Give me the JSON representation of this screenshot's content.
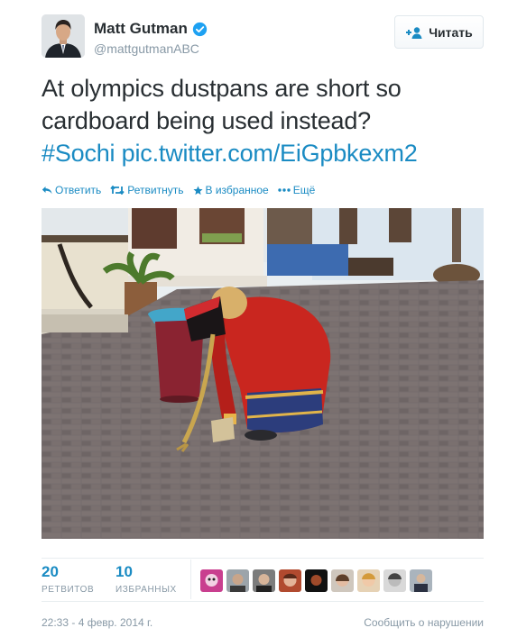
{
  "author": {
    "name": "Matt Gutman",
    "handle": "@mattgutmanABC",
    "verified": true
  },
  "follow_button": {
    "label": "Читать"
  },
  "tweet": {
    "text": "At olympics dustpans are short so cardboard being used instead?",
    "hashtag": "#Sochi",
    "link": "pic.twitter.com/EiGpbkexm2"
  },
  "actions": {
    "reply": "Ответить",
    "retweet": "Ретвитнуть",
    "favorite": "В избранное",
    "more": "Ещё"
  },
  "stats": {
    "retweets_count": "20",
    "retweets_label": "РЕТВИТОВ",
    "favorites_count": "10",
    "favorites_label": "ИЗБРАННЫХ"
  },
  "footer": {
    "timestamp": "22:33 - 4 февр. 2014 г.",
    "report": "Сообщить о нарушении"
  },
  "colors": {
    "link": "#1a8bc3",
    "muted": "#8899a6",
    "text": "#292f33",
    "verified": "#1da1f2"
  },
  "icons": [
    "reply-icon",
    "retweet-icon",
    "star-icon",
    "more-icon",
    "add-user-icon",
    "verified-badge-icon"
  ]
}
